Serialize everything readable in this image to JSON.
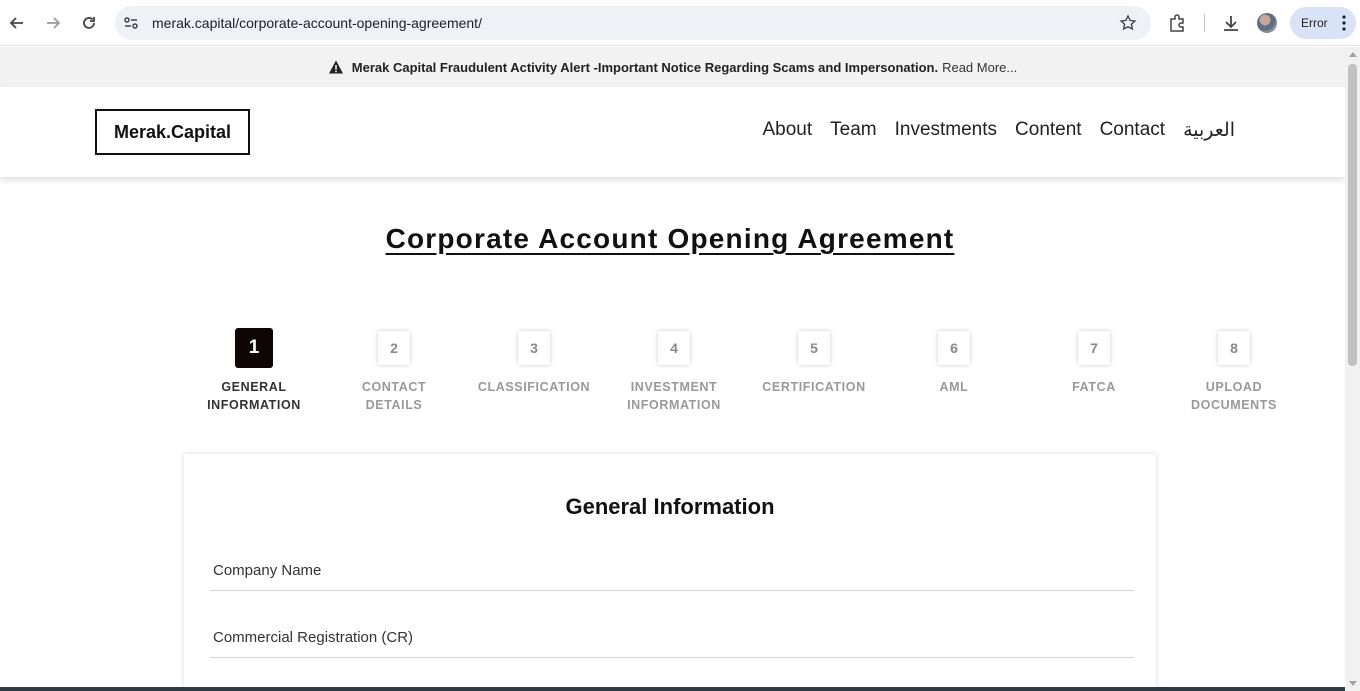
{
  "browser": {
    "url": "merak.capital/corporate-account-opening-agreement/",
    "profile_chip": "Error"
  },
  "alert": {
    "icon": "warning-icon",
    "message": "Merak Capital Fraudulent Activity Alert -Important Notice Regarding Scams and Impersonation.",
    "read_more": "Read More..."
  },
  "header": {
    "logo": "Merak.Capital",
    "nav": [
      "About",
      "Team",
      "Investments",
      "Content",
      "Contact",
      "العربية"
    ]
  },
  "page": {
    "title": "Corporate Account Opening Agreement"
  },
  "steps": [
    {
      "number": "1",
      "label": "GENERAL\nINFORMATION",
      "active": true
    },
    {
      "number": "2",
      "label": "CONTACT\nDETAILS",
      "active": false
    },
    {
      "number": "3",
      "label": "CLASSIFICATION",
      "active": false
    },
    {
      "number": "4",
      "label": "INVESTMENT\nINFORMATION",
      "active": false
    },
    {
      "number": "5",
      "label": "CERTIFICATION",
      "active": false
    },
    {
      "number": "6",
      "label": "AML",
      "active": false
    },
    {
      "number": "7",
      "label": "FATCA",
      "active": false
    },
    {
      "number": "8",
      "label": "UPLOAD\nDOCUMENTS",
      "active": false
    }
  ],
  "form": {
    "title": "General Information",
    "fields": [
      {
        "placeholder": "Company Name",
        "value": ""
      },
      {
        "placeholder": "Commercial Registration (CR)",
        "value": ""
      }
    ]
  },
  "colors": {
    "active_step": "#0f0505",
    "alert_bg": "#f2f2f2",
    "chip_bg": "#d9e3f7"
  }
}
